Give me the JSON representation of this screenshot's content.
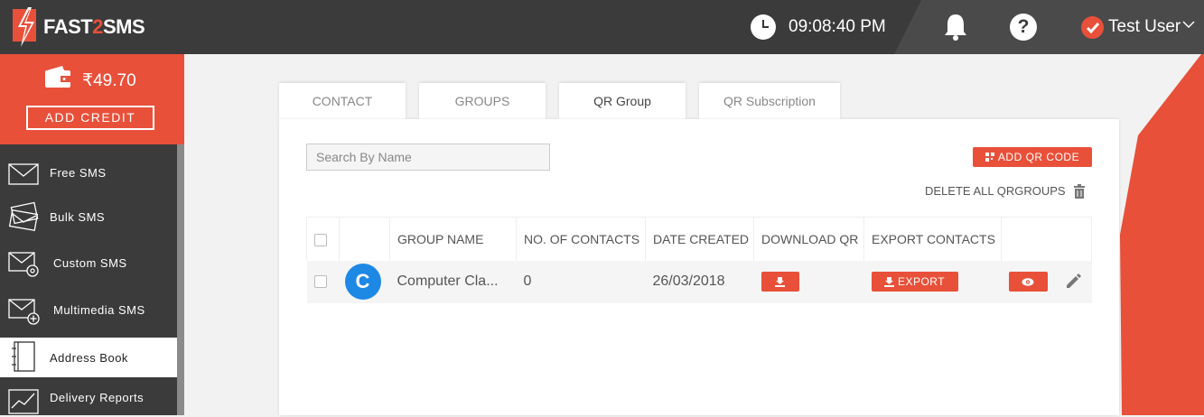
{
  "app": {
    "logo_text_a": "FAST",
    "logo_text_b": "2",
    "logo_text_c": "SMS",
    "clock_time": "09:08:40 PM",
    "user_name": "Test User",
    "brand_color": "#e8503a"
  },
  "sidebar": {
    "balance": "₹49.70",
    "add_credit_label": "ADD CREDIT",
    "items": [
      {
        "label": "Free SMS",
        "icon": "envelope-icon"
      },
      {
        "label": "Bulk SMS",
        "icon": "envelopes-icon"
      },
      {
        "label": "Custom SMS",
        "icon": "envelope-gear-icon"
      },
      {
        "label": "Multimedia SMS",
        "icon": "envelope-plus-icon"
      },
      {
        "label": "Address Book",
        "icon": "address-book-icon",
        "active": true
      },
      {
        "label": "Delivery Reports",
        "icon": "chart-icon"
      }
    ]
  },
  "tabs": [
    {
      "label": "CONTACT"
    },
    {
      "label": "GROUPS"
    },
    {
      "label": "QR Group",
      "active": true
    },
    {
      "label": "QR Subscription"
    }
  ],
  "toolbar": {
    "search_placeholder": "Search By Name",
    "add_qr_label": "ADD QR CODE",
    "delete_all_label": "DELETE ALL QRGROUPS"
  },
  "table": {
    "headers": [
      "GROUP NAME",
      "NO. OF CONTACTS",
      "DATE CREATED",
      "DOWNLOAD QR",
      "EXPORT CONTACTS"
    ],
    "rows": [
      {
        "avatar_letter": "C",
        "group_name": "Computer Cla...",
        "contacts": "0",
        "date_created": "26/03/2018",
        "export_label": "EXPORT"
      }
    ]
  }
}
